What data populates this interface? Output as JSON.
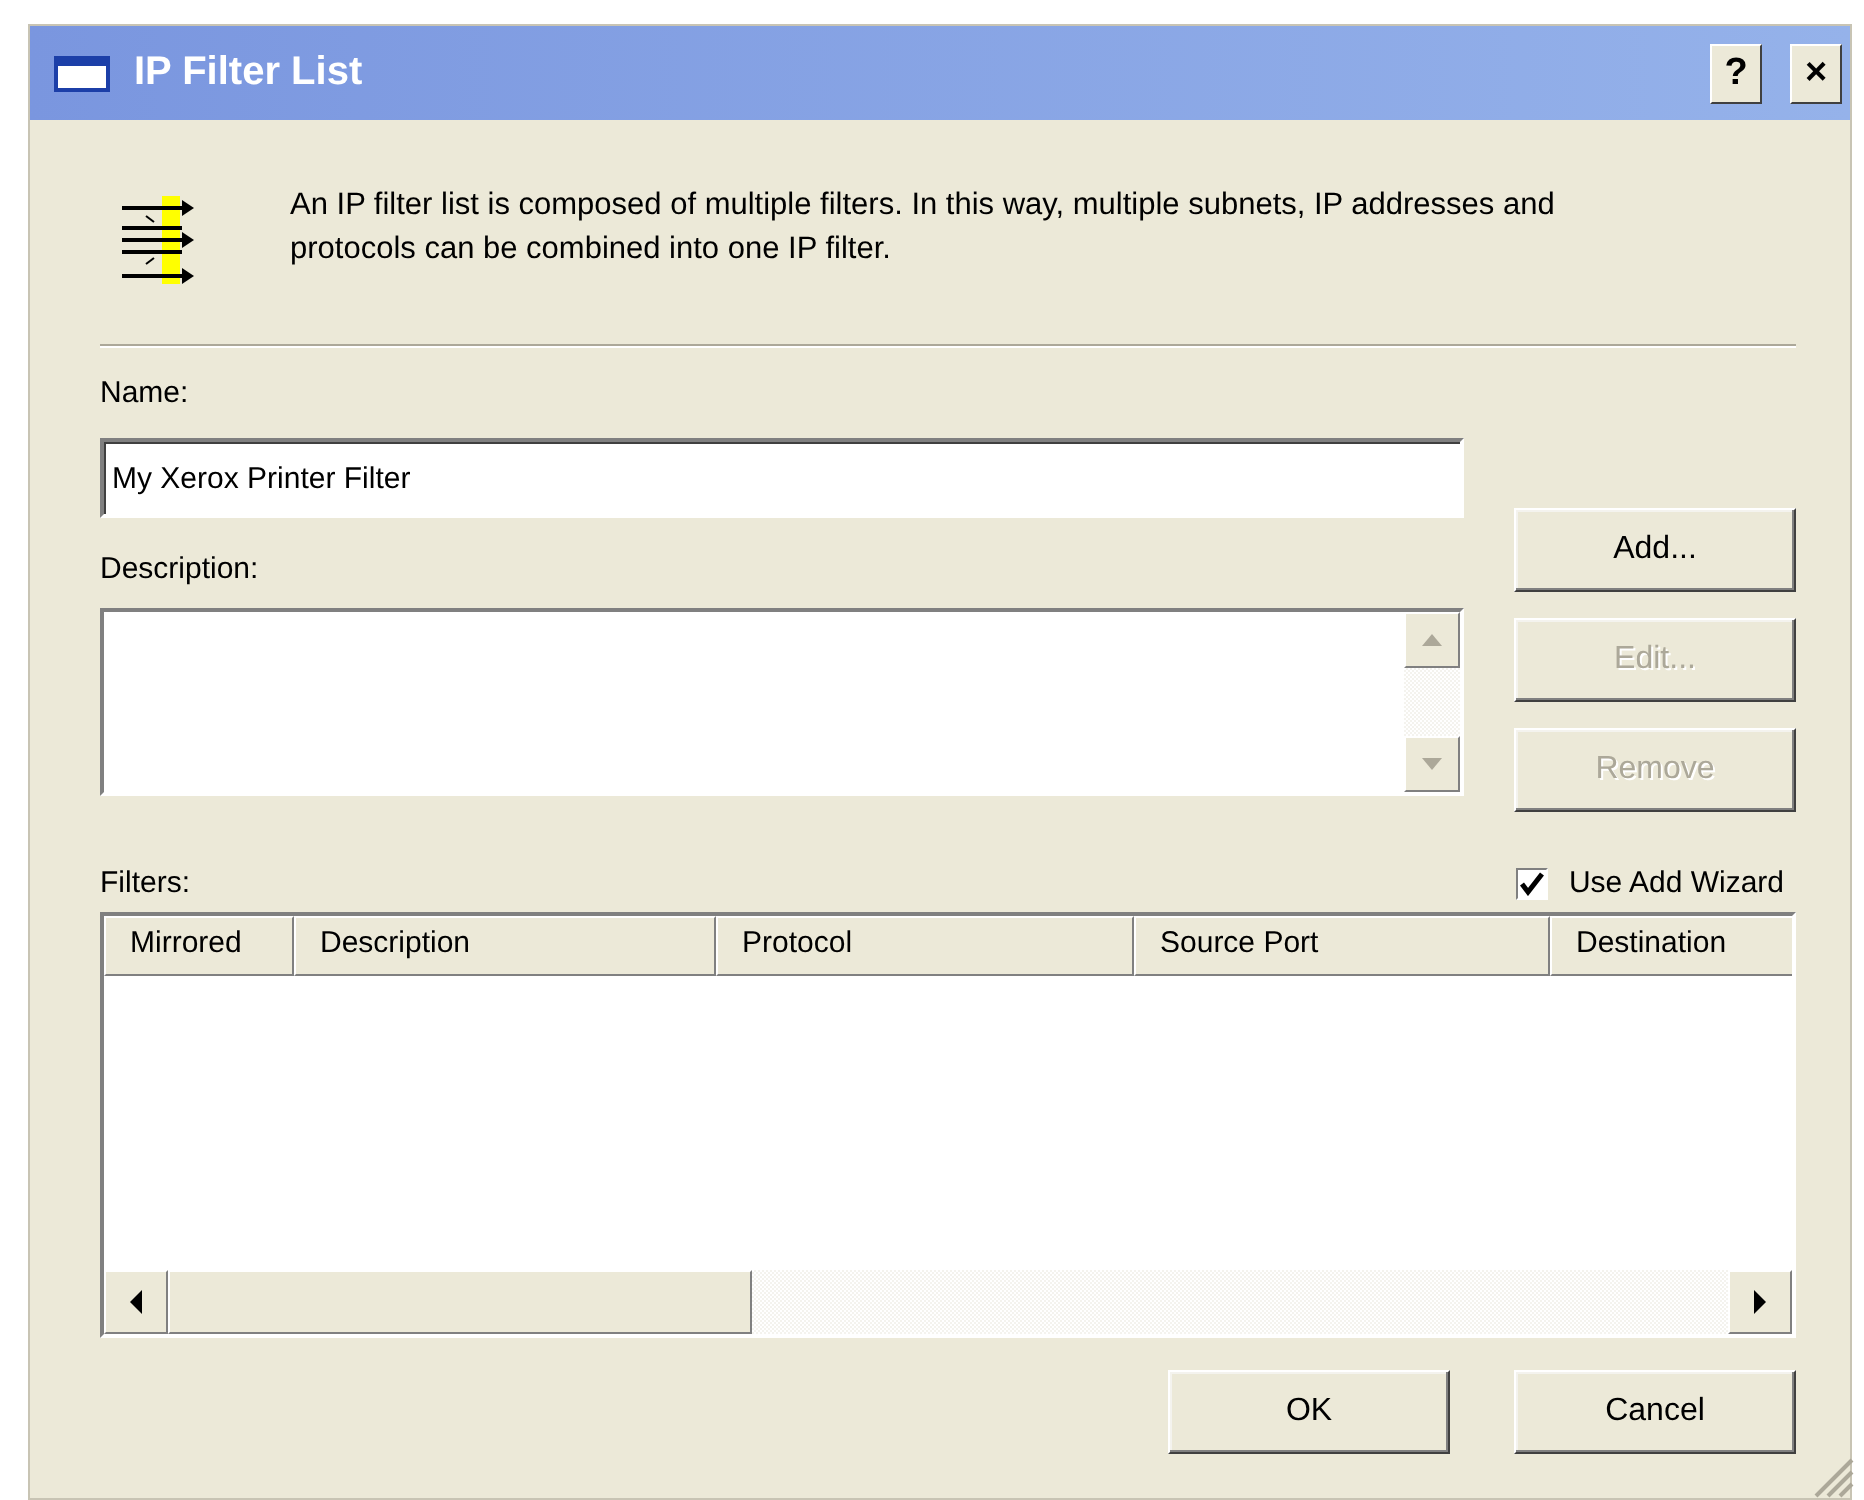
{
  "window": {
    "title": "IP Filter List",
    "help_button": "?",
    "close_button": "×"
  },
  "intro": "An IP filter list is composed of multiple filters. In this way, multiple subnets, IP addresses and protocols can be combined into one IP filter.",
  "name": {
    "label": "Name:",
    "value": "My Xerox Printer Filter"
  },
  "description": {
    "label": "Description:"
  },
  "side_buttons": [
    {
      "label": "Add...",
      "disabled": false
    },
    {
      "label": "Edit...",
      "disabled": true
    },
    {
      "label": "Remove",
      "disabled": true
    }
  ],
  "filters": {
    "label": "Filters:",
    "use_add_wizard": {
      "label": "Use Add Wizard",
      "checked": true
    },
    "columns": [
      "Mirrored",
      "Description",
      "Protocol",
      "Source Port",
      "Destination"
    ]
  },
  "buttons": [
    "OK",
    "Cancel"
  ]
}
